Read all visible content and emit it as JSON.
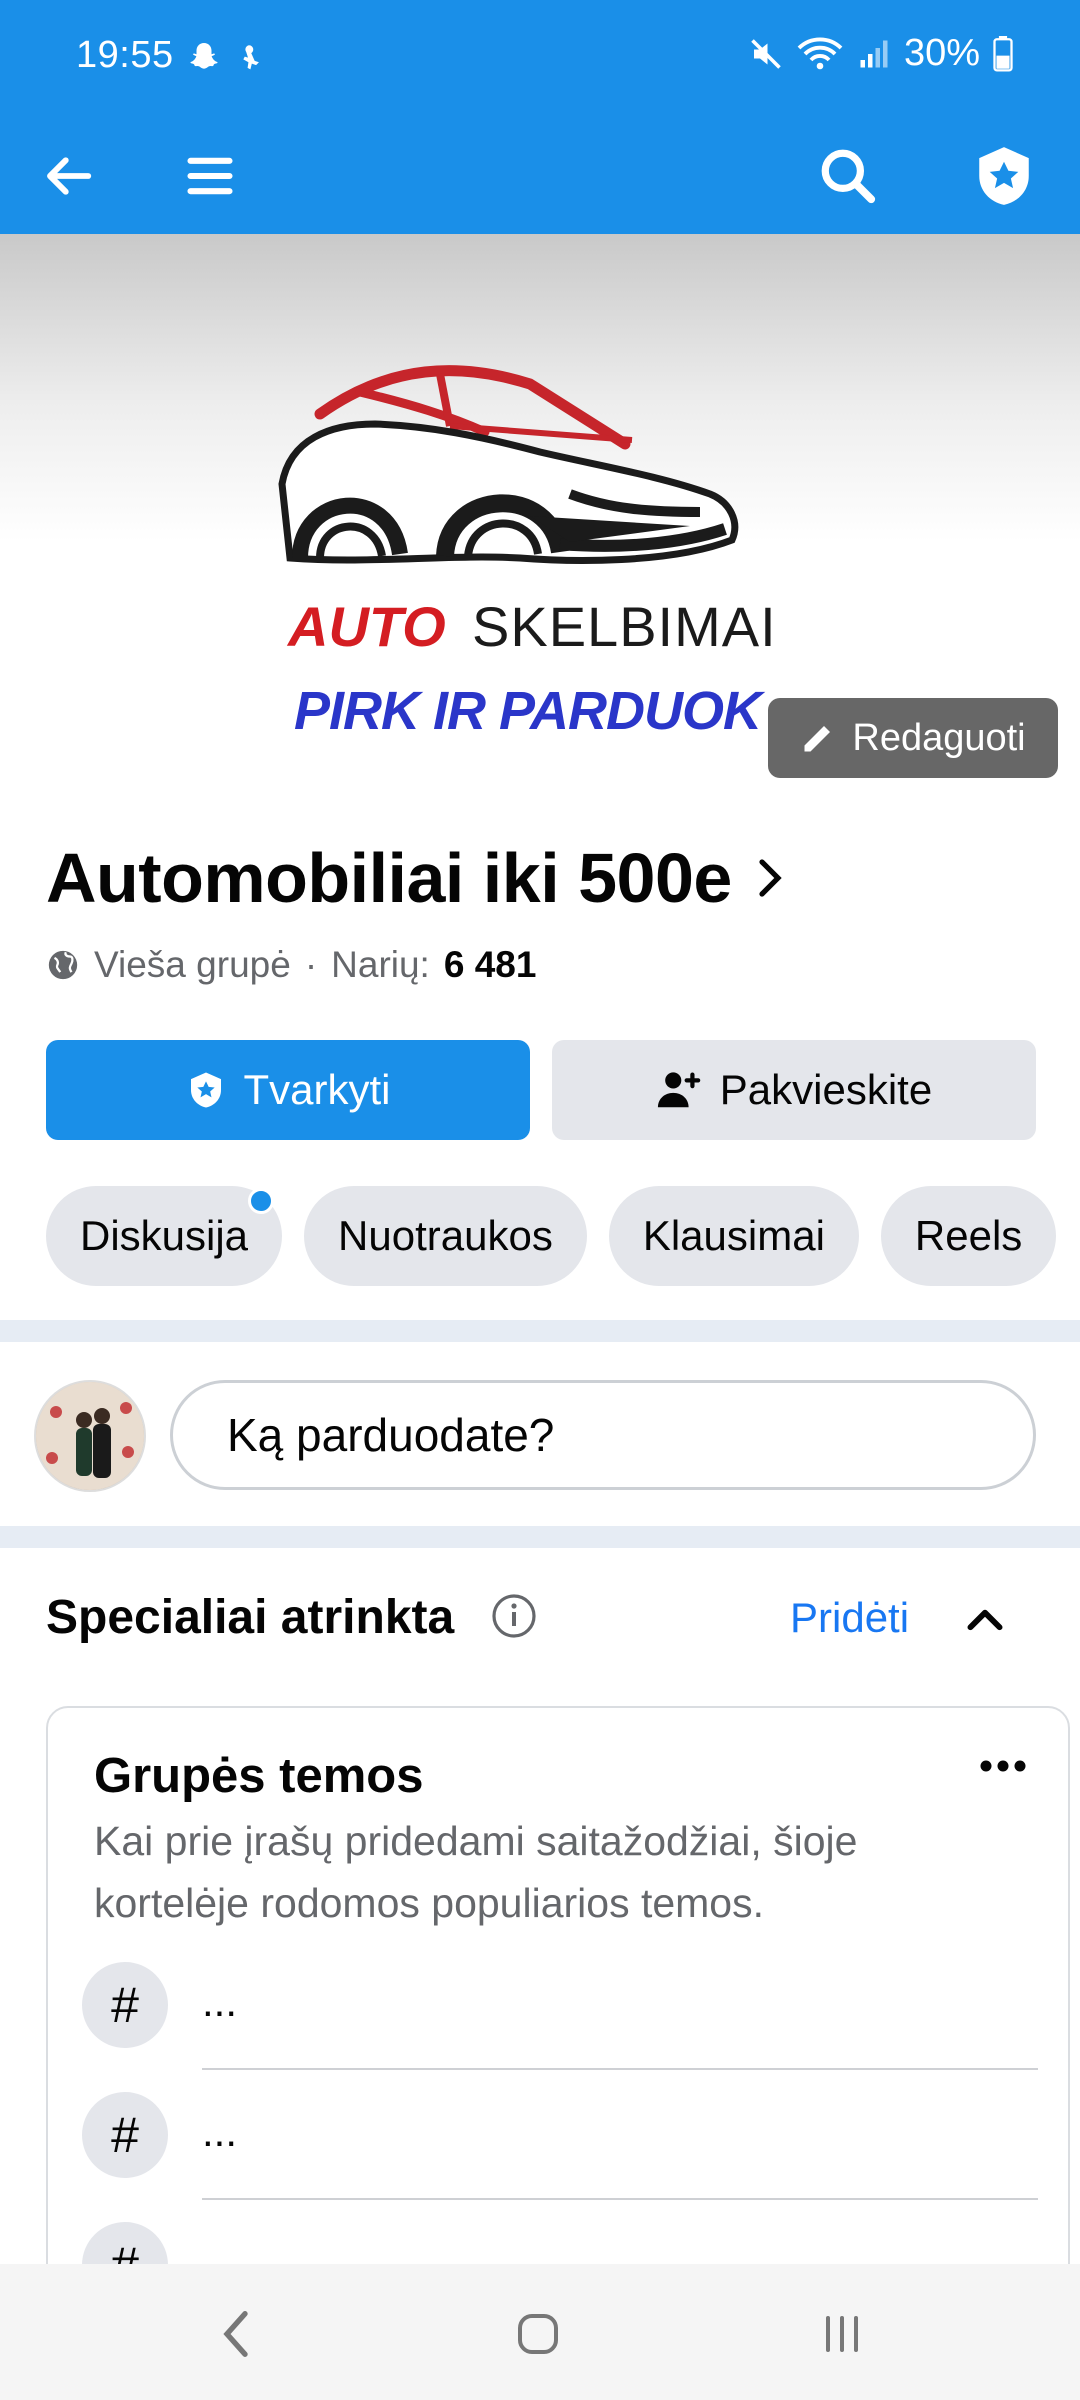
{
  "status_bar": {
    "time": "19:55",
    "battery": "30%"
  },
  "cover": {
    "logo_auto": "AUTO",
    "logo_skelbimai": "SKELBIMAI",
    "logo_slogan": "PIRK IR PARDUOK",
    "edit_label": "Redaguoti"
  },
  "group": {
    "name": "Automobiliai iki 500e",
    "privacy": "Vieša grupė",
    "members_label": "Narių:",
    "members_count": "6 481"
  },
  "actions": {
    "manage_label": "Tvarkyti",
    "invite_label": "Pakvieskite"
  },
  "tabs": [
    {
      "label": "Diskusija"
    },
    {
      "label": "Nuotraukos"
    },
    {
      "label": "Klausimai"
    },
    {
      "label": "Reels"
    }
  ],
  "composer": {
    "placeholder": "Ką parduodate?"
  },
  "featured": {
    "title": "Specialiai atrinkta",
    "add_label": "Pridėti"
  },
  "topics_card": {
    "title": "Grupės temos",
    "description": "Kai prie įrašų pridedami saitažodžiai, šioje kortelėje rodomos populiarios temos.",
    "topics": [
      {
        "hash": "#",
        "text": "..."
      },
      {
        "hash": "#",
        "text": "..."
      },
      {
        "hash": "#",
        "text": ""
      }
    ]
  },
  "colors": {
    "brand": "#1a8fe8",
    "link": "#1877f2"
  }
}
